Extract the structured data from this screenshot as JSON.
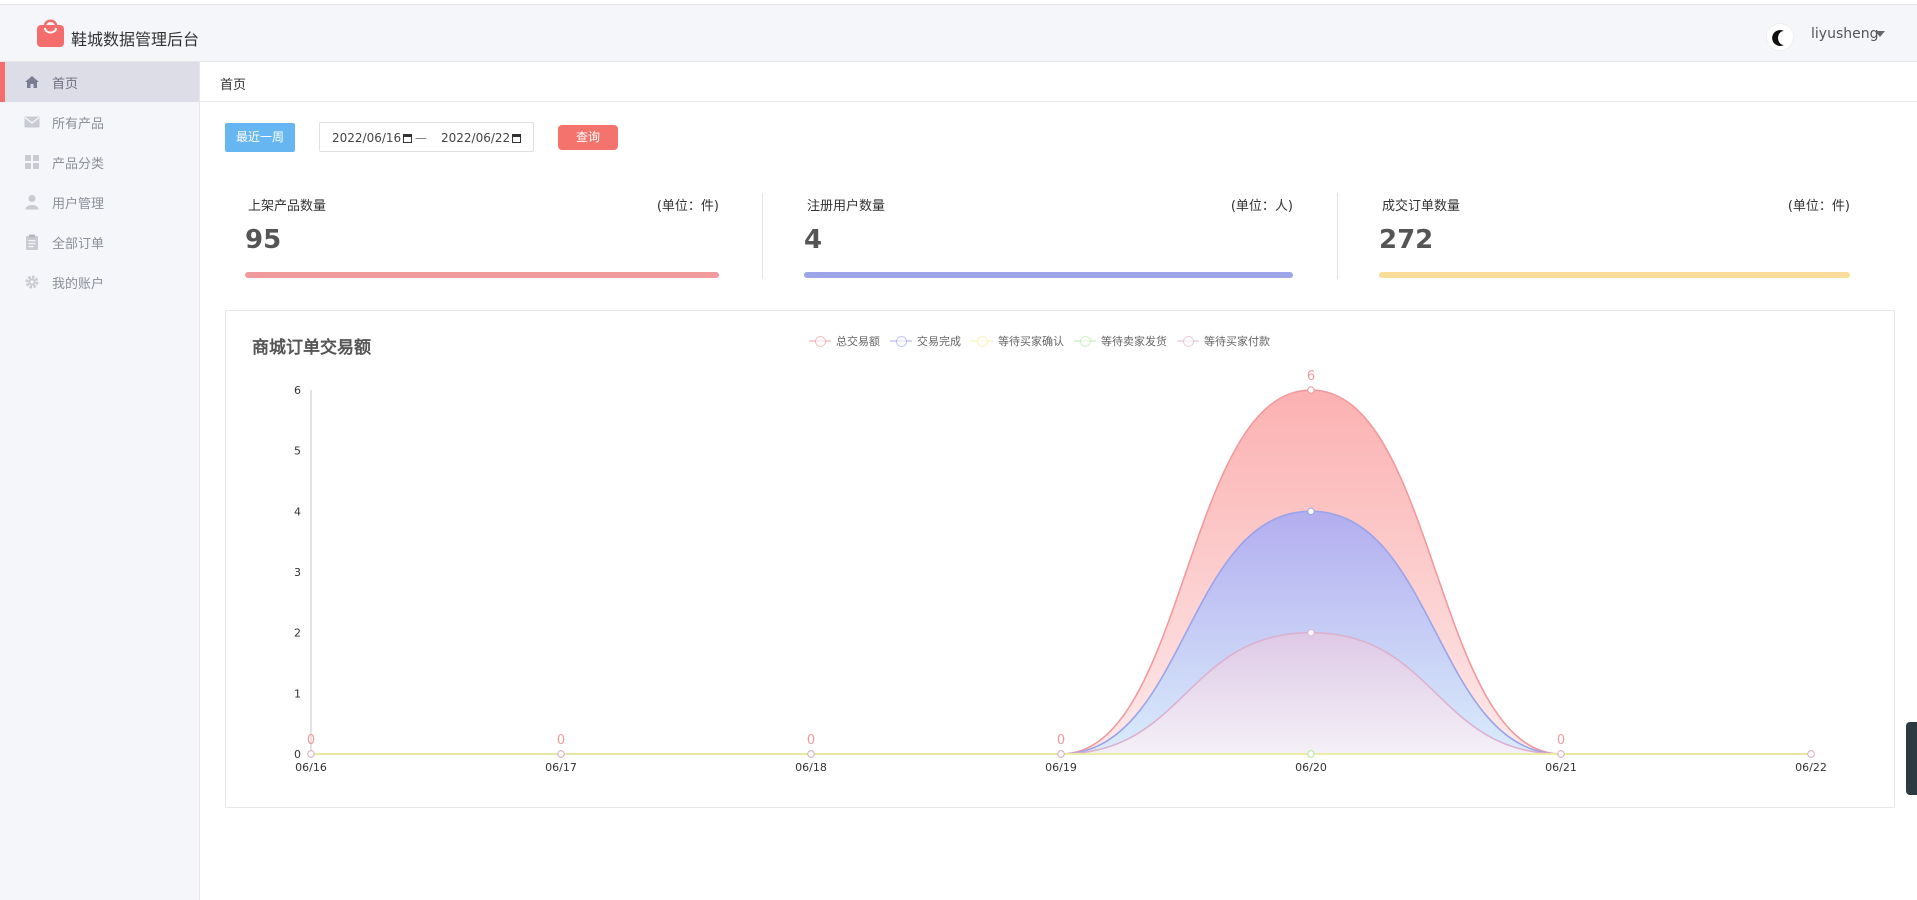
{
  "header": {
    "app_title": "鞋城数据管理后台",
    "username": "liyusheng"
  },
  "sidebar": {
    "items": [
      {
        "label": "首页",
        "icon": "home-icon",
        "active": true
      },
      {
        "label": "所有产品",
        "icon": "mail-icon",
        "active": false
      },
      {
        "label": "产品分类",
        "icon": "grid-icon",
        "active": false
      },
      {
        "label": "用户管理",
        "icon": "user-icon",
        "active": false
      },
      {
        "label": "全部订单",
        "icon": "clipboard-icon",
        "active": false
      },
      {
        "label": "我的账户",
        "icon": "gear-icon",
        "active": false
      }
    ]
  },
  "breadcrumb": "首页",
  "filters": {
    "week_button": "最近一周",
    "date_start": "2022/06/16",
    "date_separator": "—",
    "date_end": "2022/06/22",
    "query_button": "查询"
  },
  "stats": [
    {
      "label": "上架产品数量",
      "unit": "(单位：件)",
      "value": "95",
      "color": "#f09a9e"
    },
    {
      "label": "注册用户数量",
      "unit": "(单位：人)",
      "value": "4",
      "color": "#9ba5e8"
    },
    {
      "label": "成交订单数量",
      "unit": "(单位：件)",
      "value": "272",
      "color": "#fbdd9a"
    }
  ],
  "chart_title": "商城订单交易额",
  "chart_data": {
    "type": "area",
    "title": "商城订单交易额",
    "categories": [
      "06/16",
      "06/17",
      "06/18",
      "06/19",
      "06/20",
      "06/21",
      "06/22"
    ],
    "ylim": [
      0,
      6
    ],
    "yticks": [
      0,
      1,
      2,
      3,
      4,
      5,
      6
    ],
    "smooth": true,
    "grid": false,
    "legend_position": "top",
    "series": [
      {
        "name": "总交易额",
        "values": [
          0,
          0,
          0,
          0,
          6,
          0,
          0
        ],
        "color": "#f09a9e",
        "labels": true
      },
      {
        "name": "交易完成",
        "values": [
          0,
          0,
          0,
          0,
          4,
          0,
          0
        ],
        "color": "#9aa4e8",
        "labels": false
      },
      {
        "name": "等待买家确认",
        "values": [
          0,
          0,
          0,
          0,
          0,
          0,
          0
        ],
        "color": "#f3ef9b",
        "labels": false
      },
      {
        "name": "等待卖家发货",
        "values": [
          0,
          0,
          0,
          0,
          0,
          0,
          0
        ],
        "color": "#b4e6a1",
        "labels": false
      },
      {
        "name": "等待买家付款",
        "values": [
          0,
          0,
          0,
          0,
          2,
          0,
          0
        ],
        "color": "#dbb1cf",
        "labels": false
      }
    ],
    "data_labels": [
      "0",
      "0",
      "0",
      "0",
      "6",
      "0",
      ""
    ]
  }
}
